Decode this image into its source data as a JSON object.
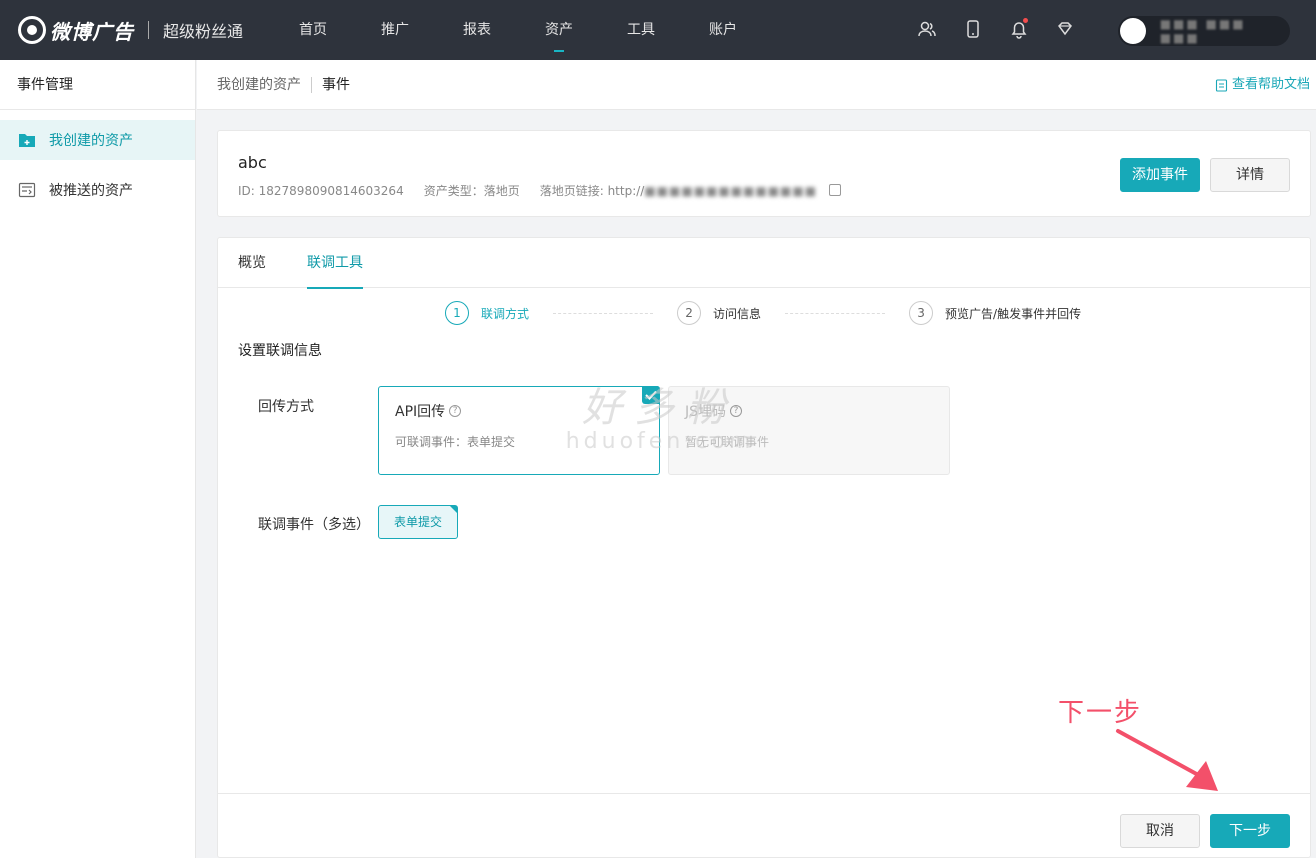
{
  "header": {
    "logo_text": "微博广告",
    "product": "超级粉丝通",
    "nav": [
      "首页",
      "推广",
      "报表",
      "资产",
      "工具",
      "账户"
    ],
    "active_nav": "资产",
    "icons": [
      "users-icon",
      "phone-icon",
      "bell-icon",
      "diamond-icon"
    ],
    "user_name": "■■■ ■■■ ■■■"
  },
  "sidebar": {
    "title": "事件管理",
    "items": [
      {
        "label": "我创建的资产",
        "icon": "folder-icon",
        "active": true
      },
      {
        "label": "被推送的资产",
        "icon": "inbox-icon",
        "active": false
      }
    ]
  },
  "breadcrumb": {
    "parent": "我创建的资产",
    "current": "事件",
    "help": "查看帮助文档"
  },
  "asset": {
    "name": "abc",
    "id": "ID: 1827898090814603264",
    "type": "资产类型：落地页",
    "link_label": "落地页链接: http://",
    "link_value": "■■■■■■■■■■■■■■",
    "add_event": "添加事件",
    "details": "详情"
  },
  "tabs": {
    "overview": "概览",
    "debug": "联调工具"
  },
  "steps": [
    {
      "num": "1",
      "label": "联调方式"
    },
    {
      "num": "2",
      "label": "访问信息"
    },
    {
      "num": "3",
      "label": "预览广告/触发事件并回传"
    }
  ],
  "form": {
    "section_title": "设置联调信息",
    "callback_label": "回传方式",
    "options": [
      {
        "title": "API回传",
        "desc": "可联调事件：表单提交"
      },
      {
        "title": "JS埋码",
        "desc": "暂无可联调事件"
      }
    ],
    "events_label": "联调事件（多选）",
    "event_tag": "表单提交"
  },
  "footer": {
    "cancel": "取消",
    "next": "下一步"
  },
  "watermark": {
    "line1": "好多粉",
    "line2": "hduofen.com"
  },
  "annotation": {
    "text": "下一步"
  },
  "colors": {
    "accent": "#17a9b8",
    "topbar": "#2e333c",
    "annotation": "#f3506a"
  }
}
